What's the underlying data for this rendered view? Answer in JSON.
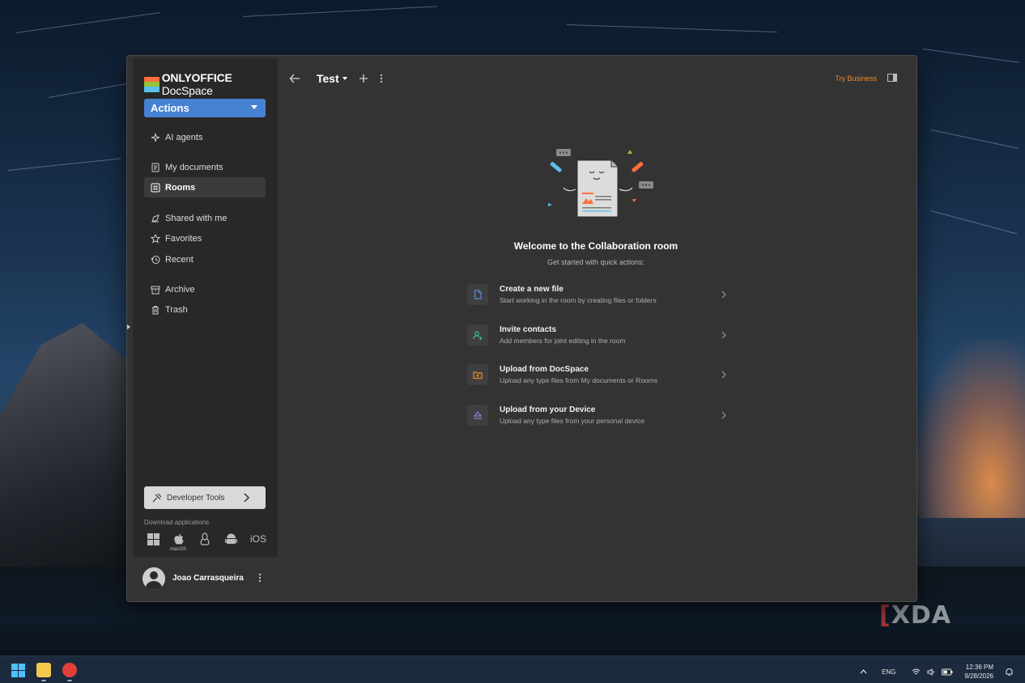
{
  "app": {
    "logo_bold": "ONLYOFFICE",
    "logo_light": " DocSpace"
  },
  "sidebar": {
    "actions_label": "Actions",
    "items": [
      {
        "label": "AI agents",
        "icon": "sparkle-icon"
      },
      {
        "label": "My documents",
        "icon": "document-icon"
      },
      {
        "label": "Rooms",
        "icon": "rooms-icon",
        "active": true
      },
      {
        "label": "Shared with me",
        "icon": "shared-icon"
      },
      {
        "label": "Favorites",
        "icon": "star-icon"
      },
      {
        "label": "Recent",
        "icon": "history-icon"
      },
      {
        "label": "Archive",
        "icon": "archive-icon"
      },
      {
        "label": "Trash",
        "icon": "trash-icon"
      }
    ],
    "dev_tools_label": "Developer Tools",
    "download_label": "Download applications",
    "os_apps": [
      "windows-icon",
      "macos-icon",
      "linux-icon",
      "android-icon",
      "ios-icon"
    ],
    "macos_caption": "macOS",
    "ios_label": "iOS",
    "user_name": "Joao Carrasqueira"
  },
  "header": {
    "room_title": "Test",
    "try_business": "Try Business"
  },
  "main": {
    "welcome_title": "Welcome to the Collaboration room",
    "welcome_sub": "Get started with quick actions:",
    "quick_actions": [
      {
        "title": "Create a new file",
        "desc": "Start working in the room by creating files or folders",
        "icon": "new-file-icon",
        "color": "#5b8bd6"
      },
      {
        "title": "Invite contacts",
        "desc": "Add members for joint editing in the room",
        "icon": "add-user-icon",
        "color": "#3fb58f"
      },
      {
        "title": "Upload from DocSpace",
        "desc": "Upload any type files from My documents or Rooms",
        "icon": "folder-upload-icon",
        "color": "#ee8a2f"
      },
      {
        "title": "Upload from your Device",
        "desc": "Upload any type files from your personal device",
        "icon": "device-upload-icon",
        "color": "#9b7be0"
      }
    ]
  },
  "taskbar": {
    "lang": "ENG",
    "time": "12:36 PM",
    "date": "9/28/2026"
  },
  "watermark": "XDA",
  "colors": {
    "accent": "#4781d1",
    "try_business": "#ee8a2f",
    "sidebar_bg": "#282828",
    "main_bg": "#333333"
  }
}
